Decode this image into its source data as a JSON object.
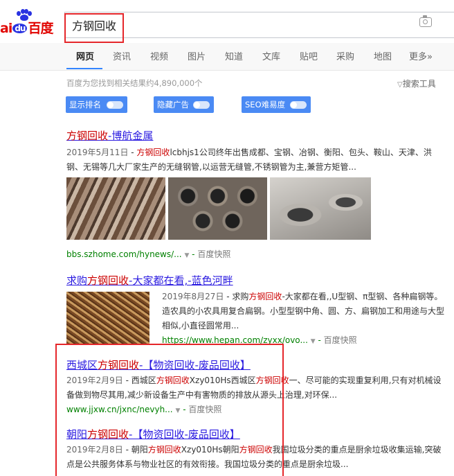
{
  "header": {
    "logo_text": "Bai du 百度",
    "search_value": "方钢回收",
    "camera_icon": "camera-icon"
  },
  "tabs": [
    "网页",
    "资讯",
    "视频",
    "图片",
    "知道",
    "文库",
    "贴吧",
    "采购",
    "地图",
    "更多»"
  ],
  "active_tab": "网页",
  "stats": "百度为您找到相关结果约4,890,000个",
  "search_tools": "搜索工具",
  "chips": [
    "显示排名",
    "隐藏广告",
    "SEO难易度"
  ],
  "results": [
    {
      "title_pre": "",
      "title_hl": "方钢回收",
      "title_post": "-博航金属",
      "date": "2019年5月11日",
      "snippet_pre": " - ",
      "snippet_hl": "方钢回收",
      "snippet_post": "lcbhjs1公司终年出售成都、宝钢、冶钢、衡阳、包头、鞍山、天津、洪钢、无锡等几大厂家生产的无缝钢管,以运营无缝管,不锈钢管为主,兼营方矩管...",
      "url": "bbs.szhome.com/hynews/...",
      "cache": "百度快照"
    },
    {
      "title_pre": "求购",
      "title_hl": "方钢回收",
      "title_post": "-大家都在看,-蓝色河畔",
      "date": "2019年8月27日",
      "snippet_pre": " - 求购",
      "snippet_hl": "方钢回收",
      "snippet_post": "-大家都在看,,U型钢、π型钢、各种扁钢等。造农具的小农具用复合扁钢。小型型钢中角、圆、方、扁钢加工和用途与大型相似,小直径圆常用...",
      "url": "https://www.hepan.com/zyxx/ovo...",
      "cache": "百度快照"
    },
    {
      "title_pre": "西城区",
      "title_hl": "方钢回收",
      "title_post": "-【物资回收-废品回收】",
      "date": "2019年2月9日",
      "snippet_pre": " - 西城区",
      "snippet_hl": "方钢回收",
      "snippet_mid": "Xzy010Hs西城区",
      "snippet_hl2": "方钢回收",
      "snippet_post": "一、尽可能的实现重复利用,只有对机械设备做到物尽其用,减少新设备生产中有害物质的排放从源头上治理,对环保...",
      "url": "www.jjxw.cn/jxnc/nevyh...",
      "cache": "百度快照"
    },
    {
      "title_pre": "朝阳",
      "title_hl": "方钢回收",
      "title_post": "-【物资回收-废品回收】",
      "date": "2019年2月8日",
      "snippet_pre": " - 朝阳",
      "snippet_hl": "方钢回收",
      "snippet_mid": "Xzy010Hs朝阳",
      "snippet_hl2": "方钢回收",
      "snippet_post": "我国垃圾分类的重点是厨余垃圾收集运输,突破点是公共服务体系与物业社区的有效衔接。我国垃圾分类的重点是厨余垃圾..."
    }
  ],
  "colors": {
    "accent": "#3385ff",
    "link": "#2a1ae0",
    "highlight": "#cc0000",
    "url": "#008000",
    "annotation": "#e5262a"
  }
}
